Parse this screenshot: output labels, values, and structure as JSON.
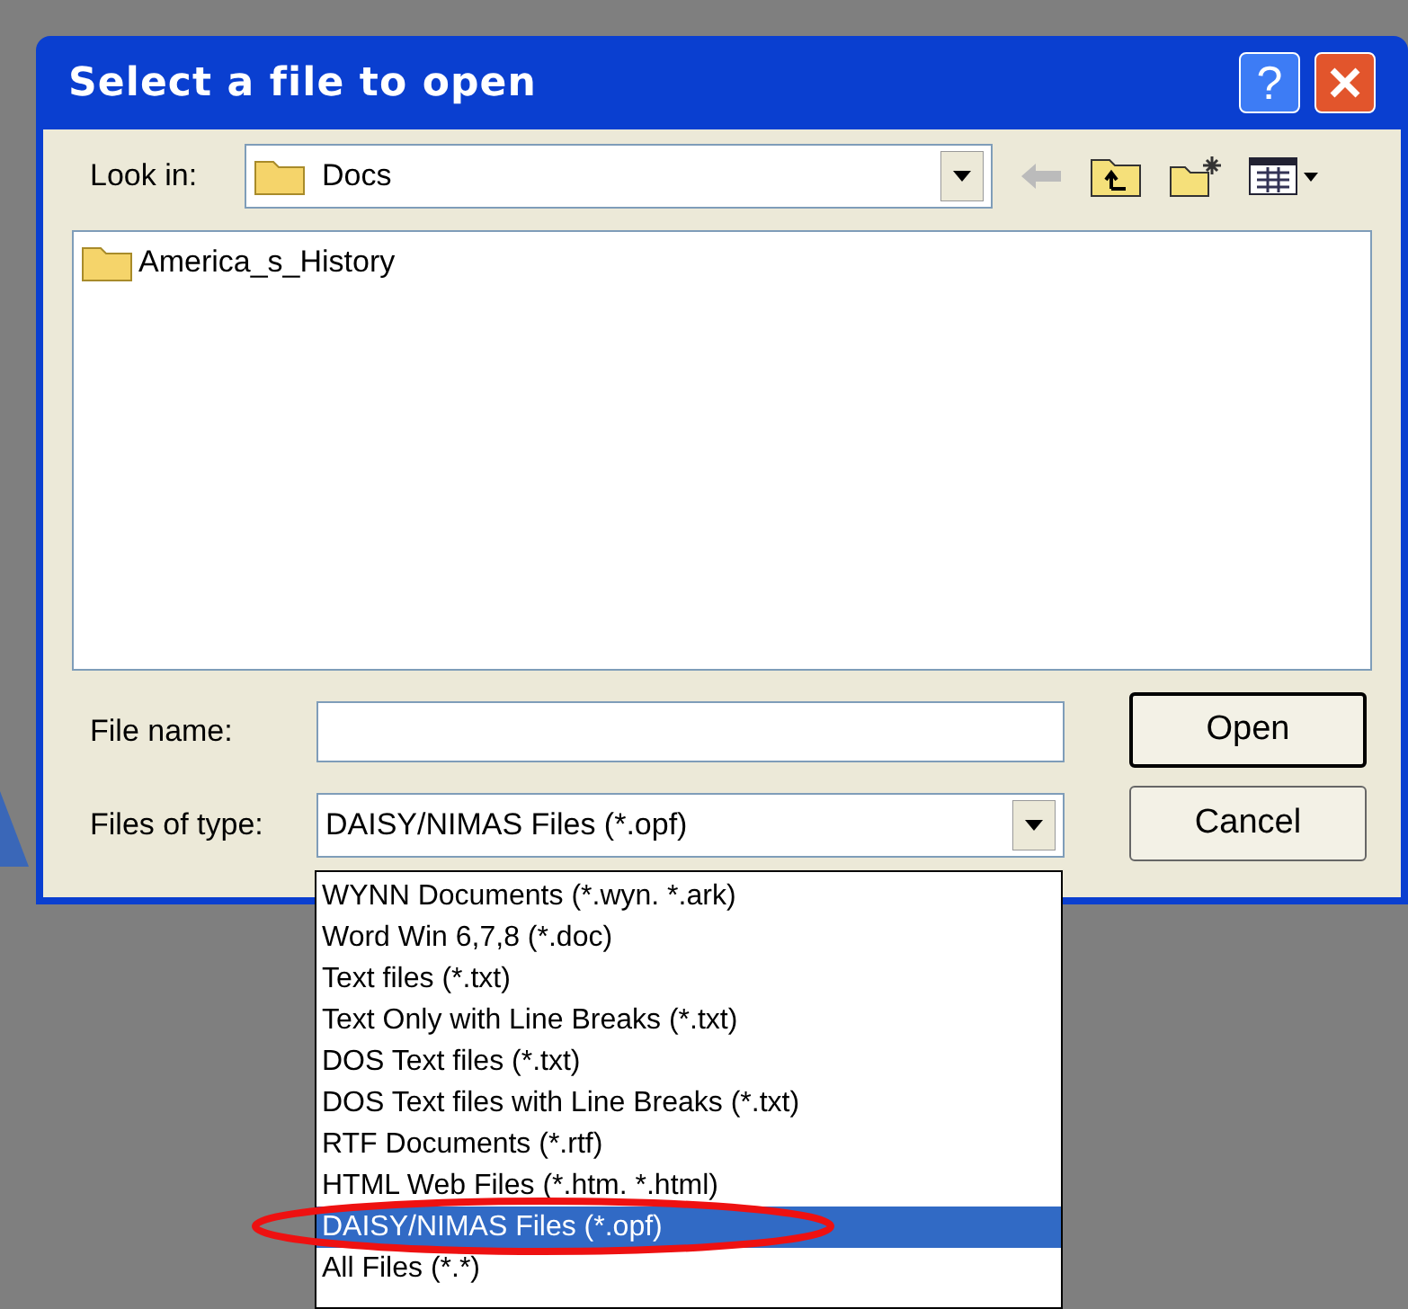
{
  "window": {
    "title": "Select a file to open",
    "buttons": [
      "?"
    ]
  },
  "look_in": {
    "label": "Look in:",
    "value": "Docs"
  },
  "files": [
    {
      "name": "America_s_History",
      "kind": "folder"
    }
  ],
  "file_name": {
    "label": "File name:"
  },
  "files_of_type": {
    "label": "Files of type:",
    "value": "DAISY/NIMAS Files (*.opf)",
    "expanded": true,
    "options": [
      {
        "label": "WYNN Documents (*.wyn. *.ark)",
        "selected": false
      },
      {
        "label": "Word Win 6,7,8 (*.doc)",
        "selected": false
      },
      {
        "label": "Text files (*.txt)",
        "selected": false
      },
      {
        "label": "Text Only with Line Breaks (*.txt)",
        "selected": false
      },
      {
        "label": "DOS Text files (*.txt)",
        "selected": false
      },
      {
        "label": "DOS Text files with Line Breaks (*.txt)",
        "selected": false
      },
      {
        "label": "RTF Documents (*.rtf)",
        "selected": false
      },
      {
        "label": "HTML Web Files (*.htm. *.html)",
        "selected": false
      },
      {
        "label": "DAISY/NIMAS Files (*.opf)",
        "selected": true
      },
      {
        "label": "All Files (*.*)",
        "selected": false
      }
    ]
  },
  "buttons": [
    {
      "label": "Open",
      "default": true
    },
    {
      "label": "Cancel",
      "default": false
    }
  ]
}
